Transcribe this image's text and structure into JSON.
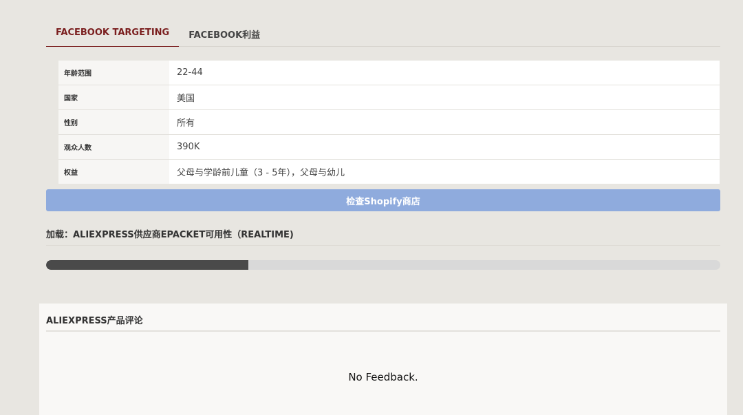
{
  "tabs": [
    {
      "label": "FACEBOOK TARGETING",
      "active": true
    },
    {
      "label": "FACEBOOK利益",
      "active": false
    }
  ],
  "targeting": {
    "rows": [
      {
        "key": "年龄范围",
        "value": "22-44"
      },
      {
        "key": "国家",
        "value": "美国"
      },
      {
        "key": "性别",
        "value": "所有"
      },
      {
        "key": "观众人数",
        "value": "390K"
      },
      {
        "key": "权益",
        "value": "父母与学龄前儿童（3 - 5年），父母与幼儿"
      }
    ]
  },
  "shop_button": {
    "label": "检查Shopify商店",
    "color": "#8fabdd"
  },
  "loading": {
    "title": "加载：ALIEXPRESS供应商EPACKET可用性（REALTIME)",
    "progress": 0.3
  },
  "reviews": {
    "title": "ALIEXPRESS产品评论",
    "empty_text": "No Feedback."
  },
  "colors": {
    "accent": "#7a1e1e",
    "background": "#e8e6e1",
    "progress_fill": "#4a4a4a",
    "progress_track": "#d9d9d9"
  }
}
